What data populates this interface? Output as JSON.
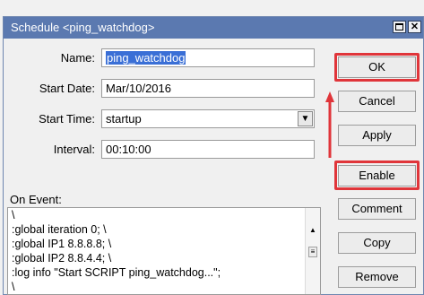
{
  "window": {
    "title": "Schedule <ping_watchdog>",
    "maximize_icon": "maximize-icon",
    "close_icon": "close-icon",
    "close_glyph": "✕"
  },
  "form": {
    "name_label": "Name:",
    "name_value": "ping_watchdog",
    "start_date_label": "Start Date:",
    "start_date_value": "Mar/10/2016",
    "start_time_label": "Start Time:",
    "start_time_value": "startup",
    "dropdown_icon": "dropdown-arrow-icon",
    "interval_label": "Interval:",
    "interval_value": "00:10:00",
    "on_event_label": "On Event:",
    "on_event_lines": [
      "\\",
      ":global iteration 0; \\",
      ":global IP1 8.8.8.8; \\",
      ":global IP2 8.8.4.4; \\",
      ":log info \"Start SCRIPT ping_watchdog...\";",
      "\\"
    ]
  },
  "buttons": {
    "ok": "OK",
    "cancel": "Cancel",
    "apply": "Apply",
    "enable": "Enable",
    "comment": "Comment",
    "copy": "Copy",
    "remove": "Remove"
  },
  "annotations": {
    "highlight_color": "#e0353a"
  }
}
